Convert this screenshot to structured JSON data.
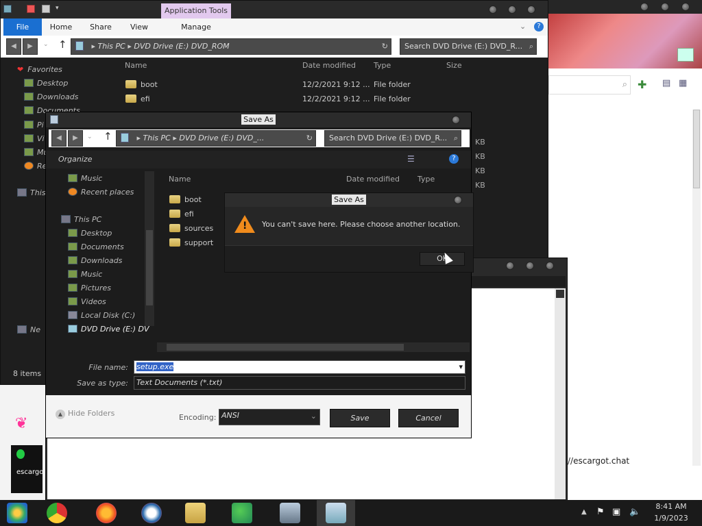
{
  "explorer": {
    "ribbon_tabs": [
      "File",
      "Home",
      "Share",
      "View",
      "Manage"
    ],
    "app_tools": "Application Tools",
    "breadcrumb": [
      "This PC",
      "DVD Drive (E:) DVD_ROM"
    ],
    "search_placeholder": "Search DVD Drive (E:) DVD_R...",
    "columns": {
      "name": "Name",
      "date": "Date modified",
      "type": "Type",
      "size": "Size"
    },
    "rows": [
      {
        "name": "boot",
        "date": "12/2/2021 9:12 ...",
        "type": "File folder"
      },
      {
        "name": "efi",
        "date": "12/2/2021 9:12 ...",
        "type": "File folder"
      }
    ],
    "size_fragments": [
      "KB",
      "KB",
      "KB",
      "KB"
    ],
    "nav": {
      "favorites": "Favorites",
      "desktop": "Desktop",
      "downloads": "Downloads",
      "documents": "Documents",
      "pi": "Pi",
      "vi": "Vi",
      "mu": "Mu",
      "re": "Re",
      "this": "This",
      "ne": "Ne"
    },
    "status": "8 items"
  },
  "saveas": {
    "title": "Save As",
    "breadcrumb": [
      "This PC",
      "DVD Drive (E:) DVD_..."
    ],
    "search_placeholder": "Search DVD Drive (E:) DVD_R...",
    "organize": "Organize",
    "columns": {
      "name": "Name",
      "date": "Date modified",
      "type": "Type"
    },
    "nav_items": [
      "Music",
      "Recent places",
      "This PC",
      "Desktop",
      "Documents",
      "Downloads",
      "Music",
      "Pictures",
      "Videos",
      "Local Disk (C:)",
      "DVD Drive (E:) DV"
    ],
    "files": [
      "boot",
      "efi",
      "sources",
      "support"
    ],
    "filename_label": "File name:",
    "filename_value": "setup.exe",
    "savetype_label": "Save as type:",
    "savetype_value": "Text Documents (*.txt)",
    "hide_folders": "Hide Folders",
    "encoding_label": "Encoding:",
    "encoding_value": "ANSI",
    "save_label": "Save",
    "cancel_label": "Cancel"
  },
  "alert": {
    "title": "Save As",
    "message": "You can't save here. Please choose another location.",
    "ok_label": "OK"
  },
  "browser": {
    "url_fragment": "//escargot.chat"
  },
  "taskbar": {
    "time": "8:41 AM",
    "date": "1/9/2023",
    "app_label": "escargo"
  },
  "colors": {
    "file_tab": "#1a6fd1",
    "app_tools": "#e2c9ee",
    "warning": "#f08b1c"
  }
}
